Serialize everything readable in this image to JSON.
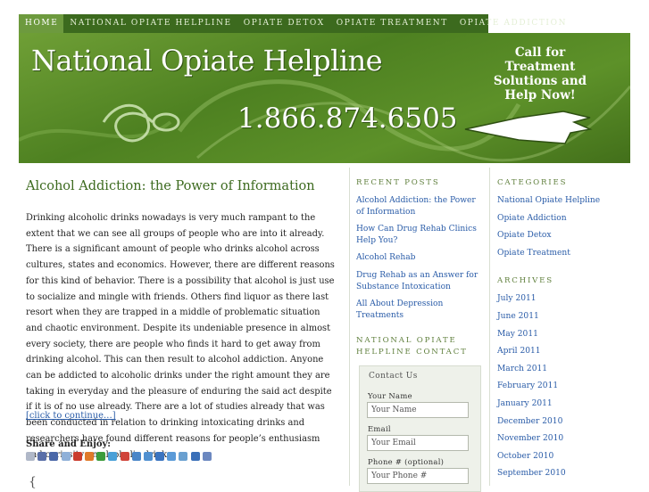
{
  "nav": {
    "items": [
      {
        "label": "Home"
      },
      {
        "label": "National Opiate Helpline"
      },
      {
        "label": "Opiate Detox"
      },
      {
        "label": "Opiate Treatment"
      },
      {
        "label": "Opiate Addiction"
      }
    ]
  },
  "header": {
    "title": "National Opiate Helpline",
    "phone": "1.866.874.6505",
    "cta_lines": [
      "Call for",
      "Treatment",
      "Solutions and",
      "Help Now!"
    ]
  },
  "post": {
    "title": "Alcohol Addiction: the Power of Information",
    "body": "Drinking alcoholic drinks nowadays is very much rampant to the extent that we can see all groups of people who are into it already. There is a significant amount of people who drinks alcohol across cultures, states and economics. However, there are different reasons for this kind of behavior. There is a possibility that alcohol is just use to socialize and mingle with friends. Others find liquor as there last resort when they are trapped in a middle of problematic situation and chaotic environment. Despite its undeniable presence in almost every society, there are people who finds it hard to get away from drinking alcohol. This can then result to alcohol addiction. Anyone can be addicted to alcoholic drinks under the right amount they are taking in everyday and the pleasure of enduring the said act despite if it is of no use already. There are a lot of studies already that was been conducted in relation to drinking intoxicating drinks and researchers have found different reasons for people’s enthusiasm and curiosity on alcoholic drinks.",
    "continue_label": "[click to continue…]",
    "share_title": "Share and Enjoy:",
    "share_icons": [
      "social-icon-1",
      "social-icon-2",
      "social-icon-3",
      "social-icon-4",
      "social-icon-5",
      "social-icon-6",
      "social-icon-7",
      "social-icon-8",
      "social-icon-9",
      "social-icon-10",
      "social-icon-11",
      "social-icon-12",
      "social-icon-13",
      "social-icon-14",
      "social-icon-15",
      "social-icon-16"
    ],
    "share_colors": [
      "#b0b8c8",
      "#5a6fa8",
      "#4a67a8",
      "#8fb0d8",
      "#ca3c2c",
      "#e07a2a",
      "#3c9c3c",
      "#4aa0d8",
      "#d0443a",
      "#4a86c8",
      "#5090d0",
      "#3a74c0",
      "#5a9ad8",
      "#6aa0d0",
      "#3a6fb8",
      "#6c88c0"
    ]
  },
  "sidebar_mid": {
    "recent_heading": "Recent Posts",
    "recent_posts": [
      "Alcohol Addiction: the Power of Information",
      "How Can Drug Rehab Clinics Help You?",
      "Alcohol Rehab",
      "Drug Rehab as an Answer for Substance Intoxication",
      "All About Depression Treatments"
    ],
    "contact_heading": "National Opiate Helpline Contact",
    "contact_legend": "Contact Us",
    "fields": {
      "name_label": "Your Name",
      "name_placeholder": "Your Name",
      "email_label": "Email",
      "email_placeholder": "Your Email",
      "phone_label": "Phone # (optional)",
      "phone_placeholder": "Your Phone #"
    }
  },
  "sidebar_right": {
    "categories_heading": "Categories",
    "categories": [
      "National Opiate Helpline",
      "Opiate Addiction",
      "Opiate Detox",
      "Opiate Treatment"
    ],
    "archives_heading": "Archives",
    "archives": [
      "July 2011",
      "June 2011",
      "May 2011",
      "April 2011",
      "March 2011",
      "February 2011",
      "January 2011",
      "December 2010",
      "November 2010",
      "October 2010",
      "September 2010"
    ]
  },
  "colors": {
    "nav_bg": "#3c6a1e",
    "nav_active": "#6d9a3e",
    "header_green": "#4e8121",
    "title_green": "#3c6a1e",
    "link_blue": "#2a5ca8"
  }
}
